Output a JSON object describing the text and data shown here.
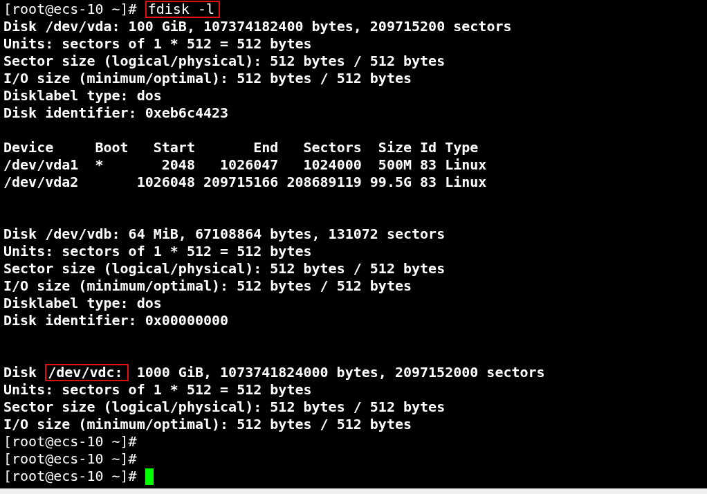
{
  "terminal": {
    "lines": [
      {
        "kind": "text",
        "bold": false,
        "segments": [
          {
            "text": "[root@ecs-10 ~]# ",
            "boxed": false
          },
          {
            "text": "fdisk -l",
            "boxed": true
          }
        ]
      },
      {
        "kind": "text",
        "bold": true,
        "segments": [
          {
            "text": "Disk /dev/vda: 100 GiB, 107374182400 bytes, 209715200 sectors",
            "boxed": false
          }
        ]
      },
      {
        "kind": "text",
        "bold": true,
        "segments": [
          {
            "text": "Units: sectors of 1 * 512 = 512 bytes",
            "boxed": false
          }
        ]
      },
      {
        "kind": "text",
        "bold": true,
        "segments": [
          {
            "text": "Sector size (logical/physical): 512 bytes / 512 bytes",
            "boxed": false
          }
        ]
      },
      {
        "kind": "text",
        "bold": true,
        "segments": [
          {
            "text": "I/O size (minimum/optimal): 512 bytes / 512 bytes",
            "boxed": false
          }
        ]
      },
      {
        "kind": "text",
        "bold": true,
        "segments": [
          {
            "text": "Disklabel type: dos",
            "boxed": false
          }
        ]
      },
      {
        "kind": "text",
        "bold": true,
        "segments": [
          {
            "text": "Disk identifier: 0xeb6c4423",
            "boxed": false
          }
        ]
      },
      {
        "kind": "blank"
      },
      {
        "kind": "text",
        "bold": true,
        "segments": [
          {
            "text": "Device     Boot   Start       End   Sectors  Size Id Type",
            "boxed": false
          }
        ]
      },
      {
        "kind": "text",
        "bold": true,
        "segments": [
          {
            "text": "/dev/vda1  *       2048   1026047   1024000  500M 83 Linux",
            "boxed": false
          }
        ]
      },
      {
        "kind": "text",
        "bold": true,
        "segments": [
          {
            "text": "/dev/vda2       1026048 209715166 208689119 99.5G 83 Linux",
            "boxed": false
          }
        ]
      },
      {
        "kind": "blank"
      },
      {
        "kind": "blank"
      },
      {
        "kind": "text",
        "bold": true,
        "segments": [
          {
            "text": "Disk /dev/vdb: 64 MiB, 67108864 bytes, 131072 sectors",
            "boxed": false
          }
        ]
      },
      {
        "kind": "text",
        "bold": true,
        "segments": [
          {
            "text": "Units: sectors of 1 * 512 = 512 bytes",
            "boxed": false
          }
        ]
      },
      {
        "kind": "text",
        "bold": true,
        "segments": [
          {
            "text": "Sector size (logical/physical): 512 bytes / 512 bytes",
            "boxed": false
          }
        ]
      },
      {
        "kind": "text",
        "bold": true,
        "segments": [
          {
            "text": "I/O size (minimum/optimal): 512 bytes / 512 bytes",
            "boxed": false
          }
        ]
      },
      {
        "kind": "text",
        "bold": true,
        "segments": [
          {
            "text": "Disklabel type: dos",
            "boxed": false
          }
        ]
      },
      {
        "kind": "text",
        "bold": true,
        "segments": [
          {
            "text": "Disk identifier: 0x00000000",
            "boxed": false
          }
        ]
      },
      {
        "kind": "blank"
      },
      {
        "kind": "blank"
      },
      {
        "kind": "text",
        "bold": true,
        "segments": [
          {
            "text": "Disk ",
            "boxed": false
          },
          {
            "text": "/dev/vdc:",
            "boxed": true
          },
          {
            "text": " 1000 GiB, 1073741824000 bytes, 2097152000 sectors",
            "boxed": false
          }
        ]
      },
      {
        "kind": "text",
        "bold": true,
        "segments": [
          {
            "text": "Units: sectors of 1 * 512 = 512 bytes",
            "boxed": false
          }
        ]
      },
      {
        "kind": "text",
        "bold": true,
        "segments": [
          {
            "text": "Sector size (logical/physical): 512 bytes / 512 bytes",
            "boxed": false
          }
        ]
      },
      {
        "kind": "text",
        "bold": true,
        "segments": [
          {
            "text": "I/O size (minimum/optimal): 512 bytes / 512 bytes",
            "boxed": false
          }
        ]
      },
      {
        "kind": "text",
        "bold": false,
        "segments": [
          {
            "text": "[root@ecs-10 ~]#",
            "boxed": false
          }
        ]
      },
      {
        "kind": "text",
        "bold": false,
        "segments": [
          {
            "text": "[root@ecs-10 ~]#",
            "boxed": false
          }
        ]
      },
      {
        "kind": "text",
        "bold": false,
        "cursor": true,
        "segments": [
          {
            "text": "[root@ecs-10 ~]# ",
            "boxed": false
          }
        ]
      }
    ]
  }
}
